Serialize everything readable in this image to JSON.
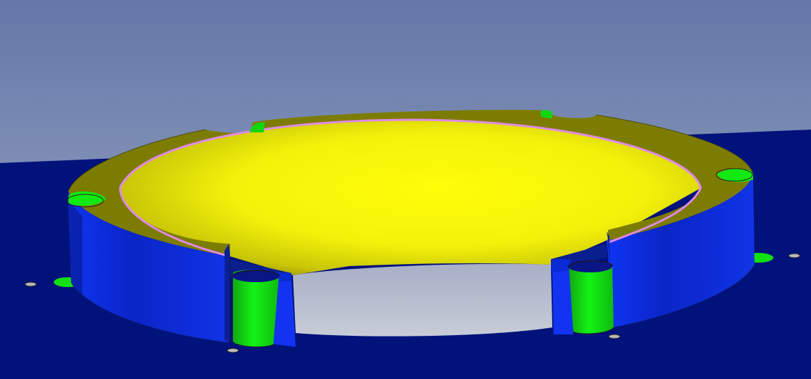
{
  "scene": {
    "description_visible_text": "",
    "colors": {
      "sky_top": "#6479a6",
      "sky_bottom": "#a8b2c8",
      "ground": "#02127c",
      "ring_top": "#7d7d02",
      "ring_outer": "#1030ee",
      "ring_inner": "#fcfc05",
      "hole_wall": "#10ee10",
      "edge_highlight": "#e38ae9",
      "gap_hole_floor": "#b4bacb"
    },
    "icons": [
      "cylindrical-ring-part",
      "mounting-hole",
      "bolt-head"
    ]
  }
}
